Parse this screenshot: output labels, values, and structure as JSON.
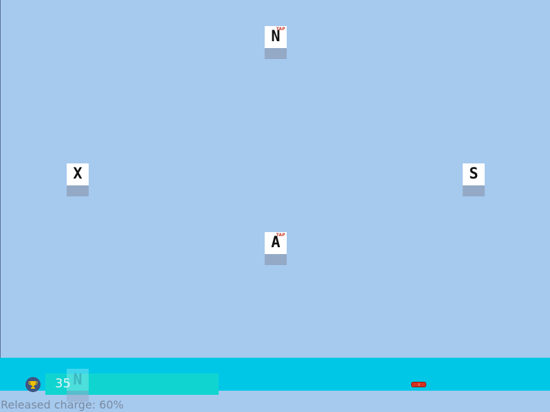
{
  "tiles": {
    "north": {
      "letter": "N",
      "badge": "TAP"
    },
    "west": {
      "letter": "X"
    },
    "east": {
      "letter": "S"
    },
    "center": {
      "letter": "A",
      "badge": "TAP"
    }
  },
  "hud": {
    "score": "35",
    "ghost_letter": "N",
    "status_text": "Released charge: 60%",
    "charge_level": 0.6
  },
  "icons": {
    "score": "trophy-icon",
    "charge": "battery-icon"
  },
  "colors": {
    "background": "#a6c9ee",
    "strip": "#00c7e6",
    "score_bar": "#10d4d0",
    "badge": "#c83a2a",
    "battery": "#d7301f"
  }
}
